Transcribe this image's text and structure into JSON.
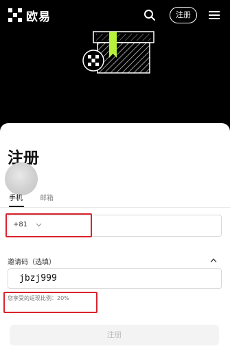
{
  "header": {
    "brand_name": "欧易",
    "signup_label": "注册"
  },
  "form": {
    "title": "注册",
    "tabs": [
      {
        "label": "手机",
        "active": true
      },
      {
        "label": "邮箱",
        "active": false
      }
    ],
    "phone": {
      "country_code": "+81",
      "value": ""
    },
    "invite": {
      "label": "邀请码（选填）",
      "value": "jbzj999"
    },
    "rebate_note": "您享受的返现比例：20%",
    "submit_label": "注册"
  },
  "colors": {
    "highlight": "#d9232d",
    "accent_green": "#b7f23a"
  },
  "icons": {
    "logo": "okx-logo-icon",
    "search": "search-icon",
    "menu": "menu-icon",
    "chevron": "chevron-down-icon",
    "collapse": "chevron-up-icon"
  }
}
